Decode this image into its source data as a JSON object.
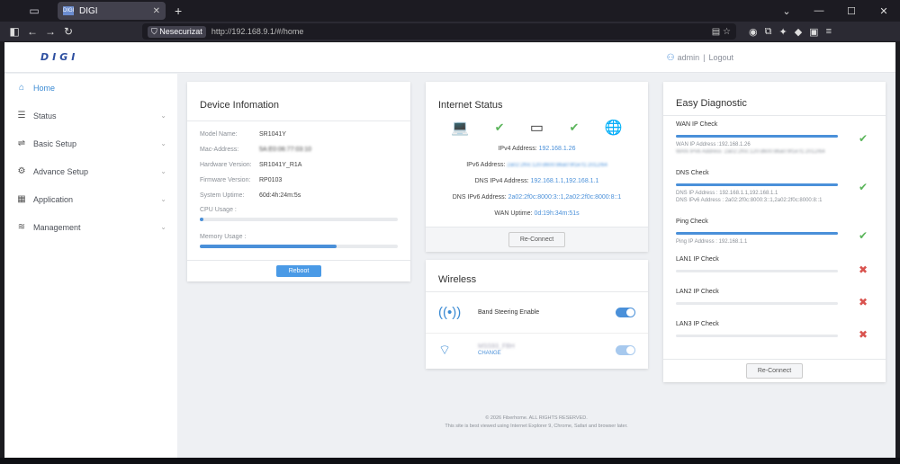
{
  "browser": {
    "tab_title": "DIGI",
    "tab_favicon": "DIGI",
    "security_label": "Nesecurizat",
    "url": "http://192.168.9.1/#/home"
  },
  "header": {
    "logo": "DIGI",
    "user": "admin",
    "separator": "|",
    "logout": "Logout"
  },
  "sidebar": {
    "items": [
      {
        "label": "Home",
        "icon": "home-icon"
      },
      {
        "label": "Status",
        "icon": "status-icon"
      },
      {
        "label": "Basic Setup",
        "icon": "basic-setup-icon"
      },
      {
        "label": "Advance Setup",
        "icon": "gear-icon"
      },
      {
        "label": "Application",
        "icon": "grid-icon"
      },
      {
        "label": "Management",
        "icon": "stack-icon"
      }
    ]
  },
  "device": {
    "title": "Device Infomation",
    "rows": [
      {
        "k": "Model Name:",
        "v": "SR1041Y"
      },
      {
        "k": "Mac-Address:",
        "v": "5A:E0:06:77:03:10"
      },
      {
        "k": "Hardware Version:",
        "v": "SR1041Y_R1A"
      },
      {
        "k": "Firmware Version:",
        "v": "RP0103"
      },
      {
        "k": "System Uptime:",
        "v": "60d:4h:24m:5s"
      }
    ],
    "cpu_label": "CPU Usage :",
    "cpu_usage": 0.02,
    "memory_label": "Memory Usage :",
    "memory_usage": 0.69,
    "reboot": "Reboot"
  },
  "internet": {
    "title": "Internet Status",
    "ipv4_label": "IPv4 Address:",
    "ipv4": "192.168.1.26",
    "ipv6_label": "IPv6 Address:",
    "ipv6": "2a02:2f0c:120:d600:86a0:9f1e:f1:2012/64",
    "dns4_label": "DNS IPv4 Address:",
    "dns4": "192.168.1.1,192.168.1.1",
    "dns6_label": "DNS IPv6 Address:",
    "dns6": "2a02:2f0c:8000:3::1,2a02:2f0c:8000:8::1",
    "uptime_label": "WAN Uptime:",
    "uptime": "0d:19h:34m:51s",
    "reconnect": "Re-Connect"
  },
  "wireless": {
    "title": "Wireless",
    "band_label": "Band Steering Enable",
    "ssid": "MSS93_FBH",
    "change": "CHANGE"
  },
  "diag": {
    "title": "Easy Diagnostic",
    "items": [
      {
        "title": "WAN IP Check",
        "progress": 1.0,
        "status": "ok",
        "info1": "WAN IP Address :192.168.1.26",
        "info2": "WAN IPv6 Address :2a02:2f0c:120:d600:86a0:9f1e:f1:2012/64"
      },
      {
        "title": "DNS Check",
        "progress": 1.0,
        "status": "ok",
        "info1": "DNS IP Address : 192.168.1.1,192.168.1.1",
        "info2": "DNS IPv6 Address : 2a02:2f0c:8000:3::1,2a02:2f0c:8000:8::1"
      },
      {
        "title": "Ping Check",
        "progress": 1.0,
        "status": "ok",
        "info1": "Ping IP Address : 192.168.1.1",
        "info2": ""
      },
      {
        "title": "LAN1 IP Check",
        "progress": 0,
        "status": "fail",
        "info1": "",
        "info2": ""
      },
      {
        "title": "LAN2 IP Check",
        "progress": 0,
        "status": "fail",
        "info1": "",
        "info2": ""
      },
      {
        "title": "LAN3 IP Check",
        "progress": 0,
        "status": "fail",
        "info1": "",
        "info2": ""
      }
    ],
    "reconnect": "Re-Connect"
  },
  "footer": {
    "line1": "© 2026 Fiberhome. ALL RIGHTS RESERVED.",
    "line2": "This site is best viewed using Internet Explorer 9, Chrome, Safari and browser later."
  },
  "colors": {
    "accent": "#4a90d9",
    "ok": "#5bb55b",
    "fail": "#d9534f"
  }
}
